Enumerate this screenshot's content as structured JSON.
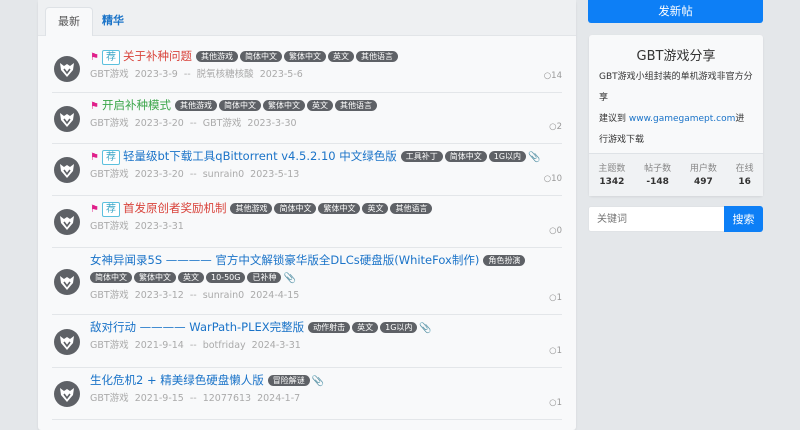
{
  "tabs": [
    {
      "label": "最新"
    },
    {
      "label": "精华"
    }
  ],
  "threads": [
    {
      "flag": true,
      "recommend": "荐",
      "title": "关于补种问题",
      "color": "#d9443c",
      "tags": [
        "其他游戏",
        "简体中文",
        "繁体中文",
        "英文",
        "其他语言"
      ],
      "attachment": false,
      "author": "GBT游戏",
      "created": "2023-3-9",
      "sep": "--",
      "last_user": "脱氧核糖核酸",
      "last_date": "2023-5-6",
      "replies": "14"
    },
    {
      "flag": true,
      "recommend": "",
      "title": "开启补种模式",
      "color": "#3ba64a",
      "tags": [
        "其他游戏",
        "简体中文",
        "繁体中文",
        "英文",
        "其他语言"
      ],
      "attachment": false,
      "author": "GBT游戏",
      "created": "2023-3-20",
      "sep": "--",
      "last_user": "GBT游戏",
      "last_date": "2023-3-30",
      "replies": "2"
    },
    {
      "flag": true,
      "recommend": "荐",
      "title": "轻量级bt下载工具qBittorrent v4.5.2.10 中文绿色版",
      "color": "#1a73c8",
      "tags": [
        "工具补丁",
        "简体中文",
        "1G以内"
      ],
      "attachment": true,
      "author": "GBT游戏",
      "created": "2023-3-20",
      "sep": "--",
      "last_user": "sunrain0",
      "last_date": "2023-5-13",
      "replies": "10"
    },
    {
      "flag": true,
      "recommend": "荐",
      "title": "首发原创者奖励机制",
      "color": "#d9443c",
      "tags": [
        "其他游戏",
        "简体中文",
        "繁体中文",
        "英文",
        "其他语言"
      ],
      "attachment": false,
      "author": "GBT游戏",
      "created": "2023-3-31",
      "sep": "",
      "last_user": "",
      "last_date": "",
      "replies": "0"
    },
    {
      "flag": false,
      "recommend": "",
      "title": "女神异闻录5S ———— 官方中文解锁豪华版全DLCs硬盘版(WhiteFox制作)",
      "color": "#1a73c8",
      "tags": [
        "角色扮演",
        "简体中文",
        "繁体中文",
        "英文",
        "10-50G",
        "已补种"
      ],
      "attachment": true,
      "author": "GBT游戏",
      "created": "2023-3-12",
      "sep": "--",
      "last_user": "sunrain0",
      "last_date": "2024-4-15",
      "replies": "1"
    },
    {
      "flag": false,
      "recommend": "",
      "title": "敌对行动 ———— WarPath-PLEX完整版",
      "color": "#1a73c8",
      "tags": [
        "动作射击",
        "英文",
        "1G以内"
      ],
      "attachment": true,
      "author": "GBT游戏",
      "created": "2021-9-14",
      "sep": "--",
      "last_user": "botfriday",
      "last_date": "2024-3-31",
      "replies": "1"
    },
    {
      "flag": false,
      "recommend": "",
      "title": "生化危机2 + 精美绿色硬盘懒人版",
      "color": "#1a73c8",
      "tags": [
        "冒险解谜"
      ],
      "attachment": true,
      "author": "GBT游戏",
      "created": "2021-9-15",
      "sep": "--",
      "last_user": "12077613",
      "last_date": "2024-1-7",
      "replies": "1"
    }
  ],
  "sidebar": {
    "new_post": "发新帖",
    "forum_name": "GBT游戏分享",
    "desc1": "GBT游戏小组封装的单机游戏非官方分享",
    "desc2_prefix": "建议到 ",
    "desc2_link": "www.gamegamept.com",
    "desc2_suffix": "进行游戏下载",
    "stats": [
      {
        "label": "主题数",
        "value": "1342"
      },
      {
        "label": "帖子数",
        "value": "-148"
      },
      {
        "label": "用户数",
        "value": "497"
      },
      {
        "label": "在线",
        "value": "16"
      }
    ],
    "search_placeholder": "关键词",
    "search_button": "搜索"
  }
}
